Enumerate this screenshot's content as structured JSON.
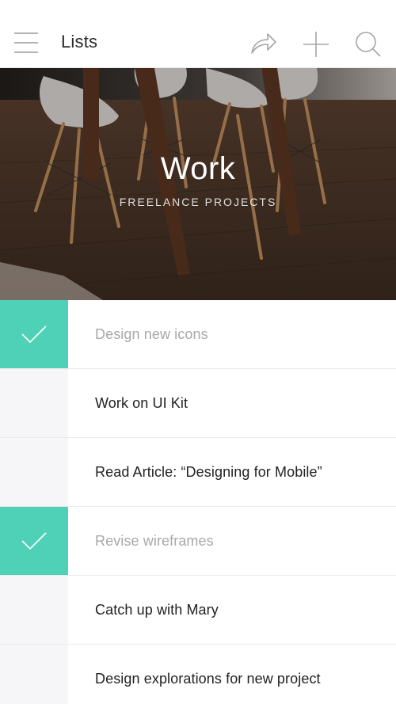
{
  "header": {
    "title": "Lists",
    "icons": [
      "hamburger-menu-icon",
      "share-arrow-icon",
      "plus-icon",
      "search-icon"
    ]
  },
  "hero": {
    "title": "Work",
    "subtitle": "FREELANCE PROJECTS",
    "image": "chairs-on-wooden-floor-photo"
  },
  "colors": {
    "accent": "#4fd1b8",
    "unchecked_cell": "#f6f6f8",
    "done_text": "#a8a8a8",
    "text": "#222222"
  },
  "tasks": [
    {
      "label": "Design new icons",
      "done": true
    },
    {
      "label": "Work on UI Kit",
      "done": false
    },
    {
      "label": "Read Article: “Designing for Mobile”",
      "done": false
    },
    {
      "label": "Revise wireframes",
      "done": true
    },
    {
      "label": "Catch up with Mary",
      "done": false
    },
    {
      "label": "Design explorations for new project",
      "done": false
    }
  ]
}
